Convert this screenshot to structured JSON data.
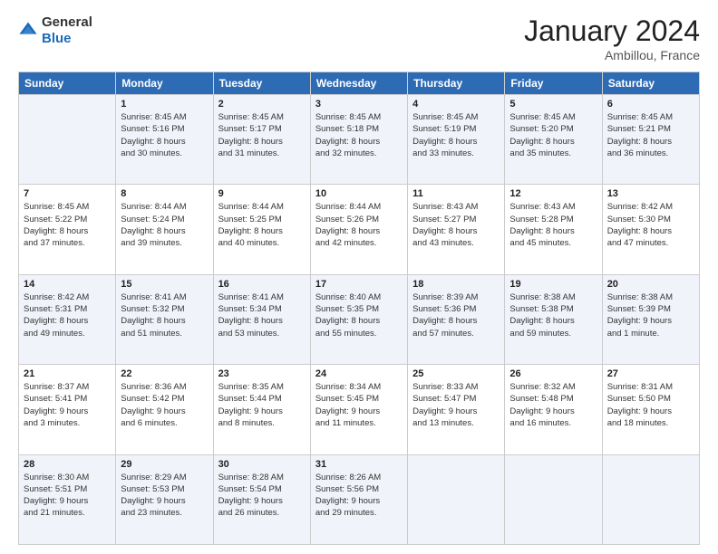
{
  "logo": {
    "general": "General",
    "blue": "Blue"
  },
  "header": {
    "title": "January 2024",
    "subtitle": "Ambillou, France"
  },
  "columns": [
    "Sunday",
    "Monday",
    "Tuesday",
    "Wednesday",
    "Thursday",
    "Friday",
    "Saturday"
  ],
  "weeks": [
    [
      {
        "day": "",
        "info": ""
      },
      {
        "day": "1",
        "info": "Sunrise: 8:45 AM\nSunset: 5:16 PM\nDaylight: 8 hours\nand 30 minutes."
      },
      {
        "day": "2",
        "info": "Sunrise: 8:45 AM\nSunset: 5:17 PM\nDaylight: 8 hours\nand 31 minutes."
      },
      {
        "day": "3",
        "info": "Sunrise: 8:45 AM\nSunset: 5:18 PM\nDaylight: 8 hours\nand 32 minutes."
      },
      {
        "day": "4",
        "info": "Sunrise: 8:45 AM\nSunset: 5:19 PM\nDaylight: 8 hours\nand 33 minutes."
      },
      {
        "day": "5",
        "info": "Sunrise: 8:45 AM\nSunset: 5:20 PM\nDaylight: 8 hours\nand 35 minutes."
      },
      {
        "day": "6",
        "info": "Sunrise: 8:45 AM\nSunset: 5:21 PM\nDaylight: 8 hours\nand 36 minutes."
      }
    ],
    [
      {
        "day": "7",
        "info": "Sunrise: 8:45 AM\nSunset: 5:22 PM\nDaylight: 8 hours\nand 37 minutes."
      },
      {
        "day": "8",
        "info": "Sunrise: 8:44 AM\nSunset: 5:24 PM\nDaylight: 8 hours\nand 39 minutes."
      },
      {
        "day": "9",
        "info": "Sunrise: 8:44 AM\nSunset: 5:25 PM\nDaylight: 8 hours\nand 40 minutes."
      },
      {
        "day": "10",
        "info": "Sunrise: 8:44 AM\nSunset: 5:26 PM\nDaylight: 8 hours\nand 42 minutes."
      },
      {
        "day": "11",
        "info": "Sunrise: 8:43 AM\nSunset: 5:27 PM\nDaylight: 8 hours\nand 43 minutes."
      },
      {
        "day": "12",
        "info": "Sunrise: 8:43 AM\nSunset: 5:28 PM\nDaylight: 8 hours\nand 45 minutes."
      },
      {
        "day": "13",
        "info": "Sunrise: 8:42 AM\nSunset: 5:30 PM\nDaylight: 8 hours\nand 47 minutes."
      }
    ],
    [
      {
        "day": "14",
        "info": "Sunrise: 8:42 AM\nSunset: 5:31 PM\nDaylight: 8 hours\nand 49 minutes."
      },
      {
        "day": "15",
        "info": "Sunrise: 8:41 AM\nSunset: 5:32 PM\nDaylight: 8 hours\nand 51 minutes."
      },
      {
        "day": "16",
        "info": "Sunrise: 8:41 AM\nSunset: 5:34 PM\nDaylight: 8 hours\nand 53 minutes."
      },
      {
        "day": "17",
        "info": "Sunrise: 8:40 AM\nSunset: 5:35 PM\nDaylight: 8 hours\nand 55 minutes."
      },
      {
        "day": "18",
        "info": "Sunrise: 8:39 AM\nSunset: 5:36 PM\nDaylight: 8 hours\nand 57 minutes."
      },
      {
        "day": "19",
        "info": "Sunrise: 8:38 AM\nSunset: 5:38 PM\nDaylight: 8 hours\nand 59 minutes."
      },
      {
        "day": "20",
        "info": "Sunrise: 8:38 AM\nSunset: 5:39 PM\nDaylight: 9 hours\nand 1 minute."
      }
    ],
    [
      {
        "day": "21",
        "info": "Sunrise: 8:37 AM\nSunset: 5:41 PM\nDaylight: 9 hours\nand 3 minutes."
      },
      {
        "day": "22",
        "info": "Sunrise: 8:36 AM\nSunset: 5:42 PM\nDaylight: 9 hours\nand 6 minutes."
      },
      {
        "day": "23",
        "info": "Sunrise: 8:35 AM\nSunset: 5:44 PM\nDaylight: 9 hours\nand 8 minutes."
      },
      {
        "day": "24",
        "info": "Sunrise: 8:34 AM\nSunset: 5:45 PM\nDaylight: 9 hours\nand 11 minutes."
      },
      {
        "day": "25",
        "info": "Sunrise: 8:33 AM\nSunset: 5:47 PM\nDaylight: 9 hours\nand 13 minutes."
      },
      {
        "day": "26",
        "info": "Sunrise: 8:32 AM\nSunset: 5:48 PM\nDaylight: 9 hours\nand 16 minutes."
      },
      {
        "day": "27",
        "info": "Sunrise: 8:31 AM\nSunset: 5:50 PM\nDaylight: 9 hours\nand 18 minutes."
      }
    ],
    [
      {
        "day": "28",
        "info": "Sunrise: 8:30 AM\nSunset: 5:51 PM\nDaylight: 9 hours\nand 21 minutes."
      },
      {
        "day": "29",
        "info": "Sunrise: 8:29 AM\nSunset: 5:53 PM\nDaylight: 9 hours\nand 23 minutes."
      },
      {
        "day": "30",
        "info": "Sunrise: 8:28 AM\nSunset: 5:54 PM\nDaylight: 9 hours\nand 26 minutes."
      },
      {
        "day": "31",
        "info": "Sunrise: 8:26 AM\nSunset: 5:56 PM\nDaylight: 9 hours\nand 29 minutes."
      },
      {
        "day": "",
        "info": ""
      },
      {
        "day": "",
        "info": ""
      },
      {
        "day": "",
        "info": ""
      }
    ]
  ]
}
